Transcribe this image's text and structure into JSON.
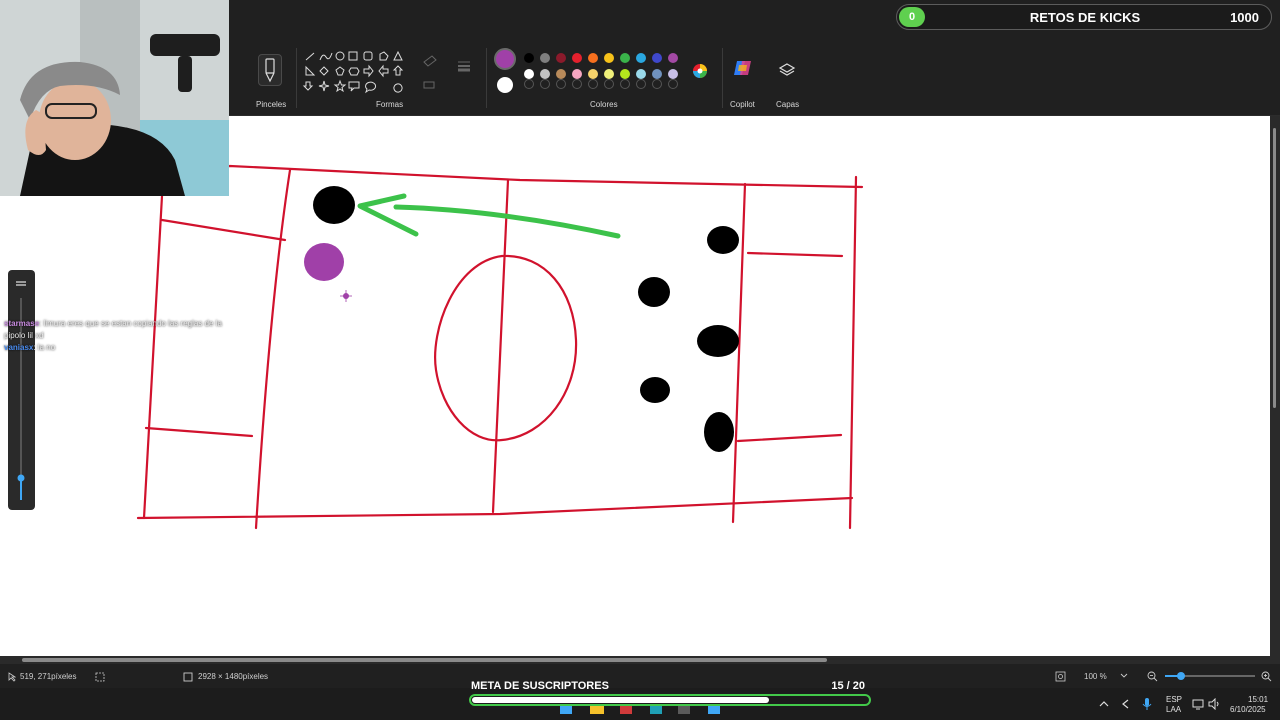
{
  "kicks_bar": {
    "count": "0",
    "title": "RETOS DE KICKS",
    "goal": "1000"
  },
  "ribbon": {
    "brushes_label": "Pinceles",
    "shapes_label": "Formas",
    "colors_label": "Colores",
    "copilot_label": "Copilot",
    "layers_label": "Capas",
    "selected_color": "#a040a8",
    "palette_row1": [
      "#000000",
      "#7f7f7f",
      "#8b1a2b",
      "#e5202d",
      "#f7701e",
      "#f7c21a",
      "#3ab34a",
      "#2aa7e0",
      "#3f48cc",
      "#a349a4"
    ],
    "palette_row2": [
      "#ffffff",
      "#c3c3c3",
      "#b88a5a",
      "#f6a6c1",
      "#f7d36b",
      "#eff07a",
      "#b5e61d",
      "#99d9ea",
      "#7092be",
      "#c8bfe7"
    ]
  },
  "chat": {
    "messages": [
      {
        "user": "starmase",
        "text": ": limura eres que se estan copiando las reglas de la pipolo lil xd"
      },
      {
        "user": "vaniasx",
        "text": ": la no"
      }
    ]
  },
  "statusbar": {
    "cursor_position": "519, 271píxeles",
    "canvas_size": "2928 × 1480píxeles",
    "zoom": "100 %"
  },
  "subscriber_goal": {
    "title": "META DE SUSCRIPTORES",
    "count": "15  / 20",
    "current": 15,
    "target": 20
  },
  "taskbar": {
    "language": "ESP",
    "language_sub": "LAA",
    "time": "15:01",
    "date": "6/10/2025"
  },
  "colors": {
    "line": "#d1122d",
    "arrow": "#3cc24a",
    "player_opponent": "#000000",
    "ball": "#a040a8",
    "accent_green": "#43c94a"
  }
}
